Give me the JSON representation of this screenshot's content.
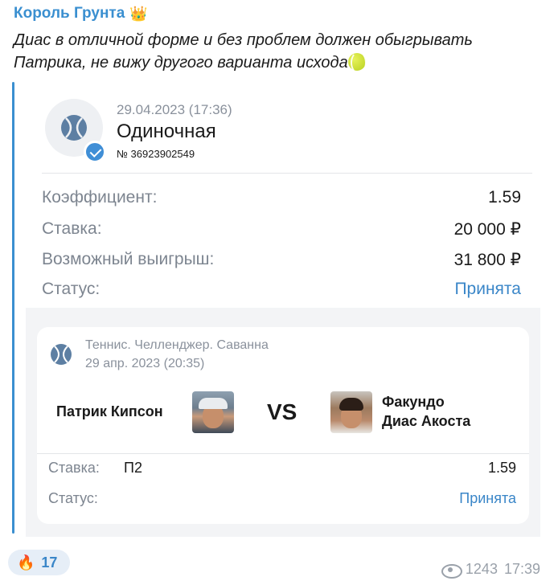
{
  "post": {
    "author": "Король Грунта",
    "author_emoji": "👑",
    "message": "Диас в отличной форме и без проблем должен обыгрывать Патрика, не вижу другого варианта исхода",
    "reaction_emoji": "🔥",
    "reaction_count": "17",
    "views": "1243",
    "time": "17:39"
  },
  "bet": {
    "date": "29.04.2023 (17:36)",
    "type": "Одиночная",
    "number": "№ 36923902549",
    "rows": [
      {
        "label": "Коэффициент:",
        "value": "1.59"
      },
      {
        "label": "Ставка:",
        "value": "20 000 ₽"
      },
      {
        "label": "Возможный выигрыш:",
        "value": "31 800 ₽"
      },
      {
        "label": "Статус:",
        "value": "Принята"
      }
    ]
  },
  "event": {
    "title": "Теннис. Челленджер. Саванна",
    "date": "29 апр. 2023 (20:35)",
    "player1": "Патрик Кипсон",
    "vs": "VS",
    "player2_line1": "Факундо",
    "player2_line2": "Диас Акоста",
    "stake_label": "Ставка:",
    "pick": "П2",
    "odds": "1.59",
    "status_label": "Статус:",
    "status": "Принята"
  },
  "colors": {
    "accent": "#3a8fd0",
    "status": "#3a86c8"
  }
}
